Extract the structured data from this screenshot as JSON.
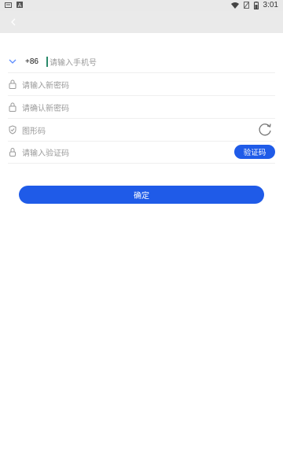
{
  "status_bar": {
    "time": "3:01"
  },
  "form": {
    "country_code": "+86",
    "phone_placeholder": "请输入手机号",
    "new_password_placeholder": "请输入新密码",
    "confirm_password_placeholder": "请确认新密码",
    "captcha_placeholder": "图形码",
    "sms_code_placeholder": "请输入验证码",
    "get_code_label": "验证码"
  },
  "confirm_label": "确定",
  "colors": {
    "accent": "#1f5be8",
    "caret": "#2a8a6a"
  }
}
